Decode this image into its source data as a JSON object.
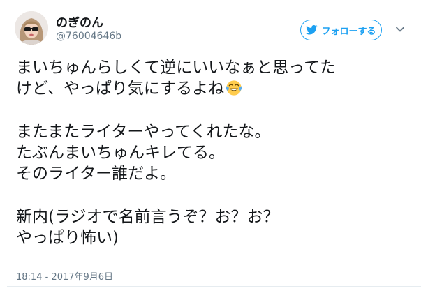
{
  "user": {
    "display_name": "のぎのん",
    "handle": "@76004646b"
  },
  "follow_button": {
    "label": "フォローする",
    "icon": "follow-bird-icon"
  },
  "menu_icon": "chevron-down-icon",
  "tweet": {
    "lines": [
      "まいちゅんらしくて逆にいいなぁと思ってた",
      "けど、やっぱり気にするよね",
      "またまたライターやってくれたな。",
      "たぶんまいちゅんキレてる。",
      "そのライター誰だよ。",
      "新内(ラジオで名前言うぞ？お？お？",
      "やっぱり怖い)"
    ],
    "emoji": "face-with-tears-of-joy"
  },
  "timestamp": "18:14 - 2017年9月6日",
  "colors": {
    "accent": "#1da1f2",
    "text": "#14171a",
    "muted": "#657786"
  }
}
